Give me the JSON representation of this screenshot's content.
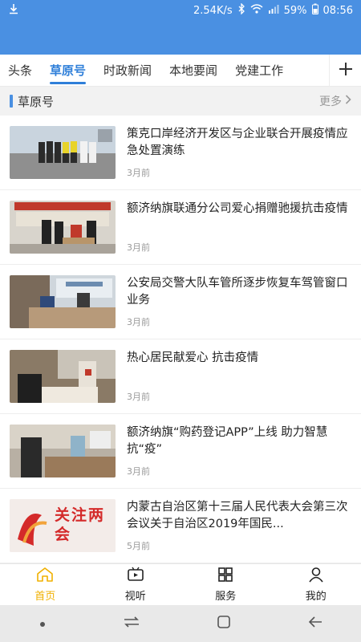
{
  "status_bar": {
    "left_icon": "download-icon",
    "speed": "2.54K/s",
    "battery": "59%",
    "time": "08:56"
  },
  "tabs": [
    {
      "label": "头条",
      "active": false
    },
    {
      "label": "草原号",
      "active": true
    },
    {
      "label": "时政新闻",
      "active": false
    },
    {
      "label": "本地要闻",
      "active": false
    },
    {
      "label": "党建工作",
      "active": false
    }
  ],
  "section": {
    "title": "草原号",
    "more": "更多"
  },
  "news": [
    {
      "title": "策克口岸经济开发区与企业联合开展疫情应急处置演练",
      "time": "3月前"
    },
    {
      "title": "额济纳旗联通分公司爱心捐赠驰援抗击疫情",
      "time": "3月前"
    },
    {
      "title": "公安局交警大队车管所逐步恢复车驾管窗口业务",
      "time": "3月前"
    },
    {
      "title": "热心居民献爱心 抗击疫情",
      "time": "3月前"
    },
    {
      "title": "额济纳旗“购药登记APP”上线 助力智慧抗“疫”",
      "time": "3月前"
    },
    {
      "title": "内蒙古自治区第十三届人民代表大会第三次会议关于自治区2019年国民...",
      "time": "5月前",
      "thumb_text": "关注两会"
    }
  ],
  "bottom_nav": [
    {
      "label": "首页",
      "icon": "home-icon",
      "active": true
    },
    {
      "label": "视听",
      "icon": "video-icon",
      "active": false
    },
    {
      "label": "服务",
      "icon": "grid-icon",
      "active": false
    },
    {
      "label": "我的",
      "icon": "user-icon",
      "active": false
    }
  ],
  "colors": {
    "brand_blue": "#4a90e2",
    "active_tab": "#2f7fd9",
    "active_nav": "#f0b000"
  }
}
